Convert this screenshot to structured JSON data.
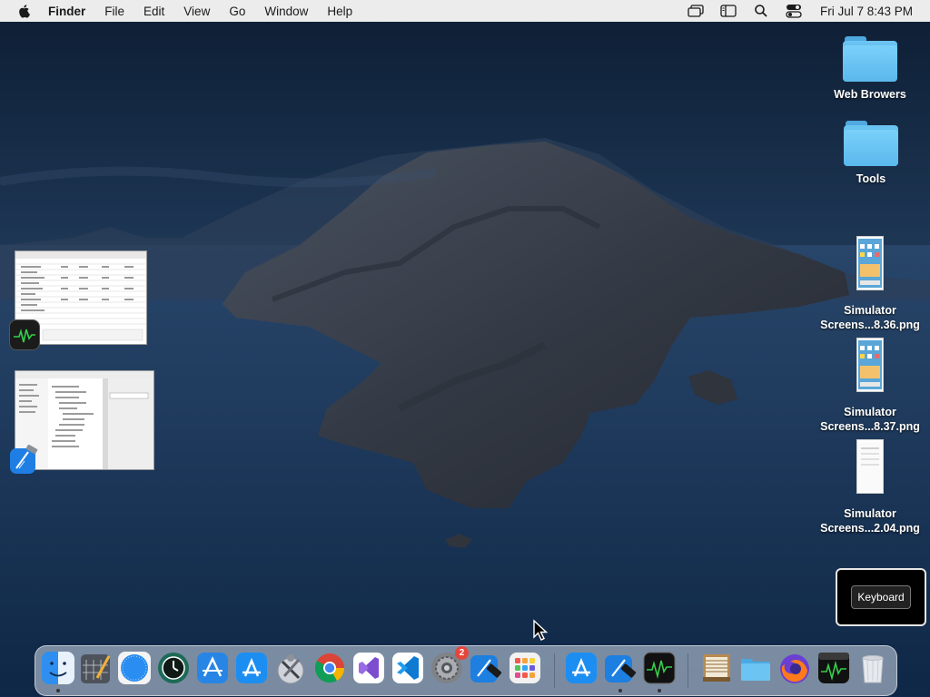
{
  "menubar": {
    "app_name": "Finder",
    "menus": [
      "File",
      "Edit",
      "View",
      "Go",
      "Window",
      "Help"
    ],
    "clock": "Fri Jul 7  8:43 PM",
    "status_icons": [
      "screen-mirroring-icon",
      "sidebar-toggle-icon",
      "spotlight-search-icon",
      "control-center-icon"
    ]
  },
  "desktop": {
    "icons": [
      {
        "label": "Web Browers",
        "kind": "folder"
      },
      {
        "label": "Tools",
        "kind": "folder"
      },
      {
        "label_line1": "Simulator",
        "label_line2": "Screens...8.36.png",
        "kind": "image"
      },
      {
        "label_line1": "Simulator",
        "label_line2": "Screens...8.37.png",
        "kind": "image"
      },
      {
        "label_line1": "Simulator",
        "label_line2": "Screens...2.04.png",
        "kind": "image"
      }
    ]
  },
  "keyboard_panel": {
    "button_label": "Keyboard"
  },
  "dock": {
    "apps": [
      {
        "name": "Finder",
        "icon": "finder-icon",
        "color": "#2f8ff0",
        "running": true
      },
      {
        "name": "Script Editor",
        "icon": "script-editor-icon",
        "color": "#5a5e66",
        "running": false
      },
      {
        "name": "Safari",
        "icon": "safari-icon",
        "color": "#2a8df2",
        "running": false
      },
      {
        "name": "Time Machine",
        "icon": "time-machine-icon",
        "color": "#1d6b57",
        "running": false
      },
      {
        "name": "Xcode Instruments",
        "icon": "instruments-icon",
        "color": "#2785e6",
        "running": false
      },
      {
        "name": "App Store",
        "icon": "app-store-icon",
        "color": "#1c8ef2",
        "running": false
      },
      {
        "name": "Xcode Tools",
        "icon": "xcode-tools-icon",
        "color": "#cfd3d9",
        "running": false
      },
      {
        "name": "Chrome",
        "icon": "chrome-icon",
        "color": "#ffffff",
        "running": false
      },
      {
        "name": "Visual Studio",
        "icon": "visual-studio-icon",
        "color": "#ffffff",
        "running": false
      },
      {
        "name": "VS Code",
        "icon": "vscode-icon",
        "color": "#ffffff",
        "running": false
      },
      {
        "name": "System Preferences",
        "icon": "system-preferences-icon",
        "color": "#7f8287",
        "running": false,
        "badge": "2"
      },
      {
        "name": "Xcode",
        "icon": "xcode-icon",
        "color": "#1d7fe0",
        "running": false
      },
      {
        "name": "Launchpad",
        "icon": "launchpad-icon",
        "color": "#f2f2f2",
        "running": false
      },
      {
        "name": "App Store 2",
        "icon": "app-store-icon",
        "color": "#1c8ef2",
        "running": false
      },
      {
        "name": "Xcode 2",
        "icon": "xcode-icon",
        "color": "#1d7fe0",
        "running": true
      },
      {
        "name": "Activity Monitor",
        "icon": "activity-monitor-icon",
        "color": "#111111",
        "running": true
      },
      {
        "name": "Archive Utility",
        "icon": "archive-icon",
        "color": "#b88a4e",
        "running": false
      },
      {
        "name": "Downloads Folder",
        "icon": "folder-icon",
        "color": "#5ab8ec",
        "running": false
      },
      {
        "name": "Firefox",
        "icon": "firefox-icon",
        "color": "#6a3fd1",
        "running": false
      },
      {
        "name": "Activity Monitor 2",
        "icon": "activity-monitor-icon",
        "color": "#111111",
        "running": false
      },
      {
        "name": "Trash",
        "icon": "trash-icon",
        "color": "#e6e9ee",
        "running": false
      }
    ]
  }
}
